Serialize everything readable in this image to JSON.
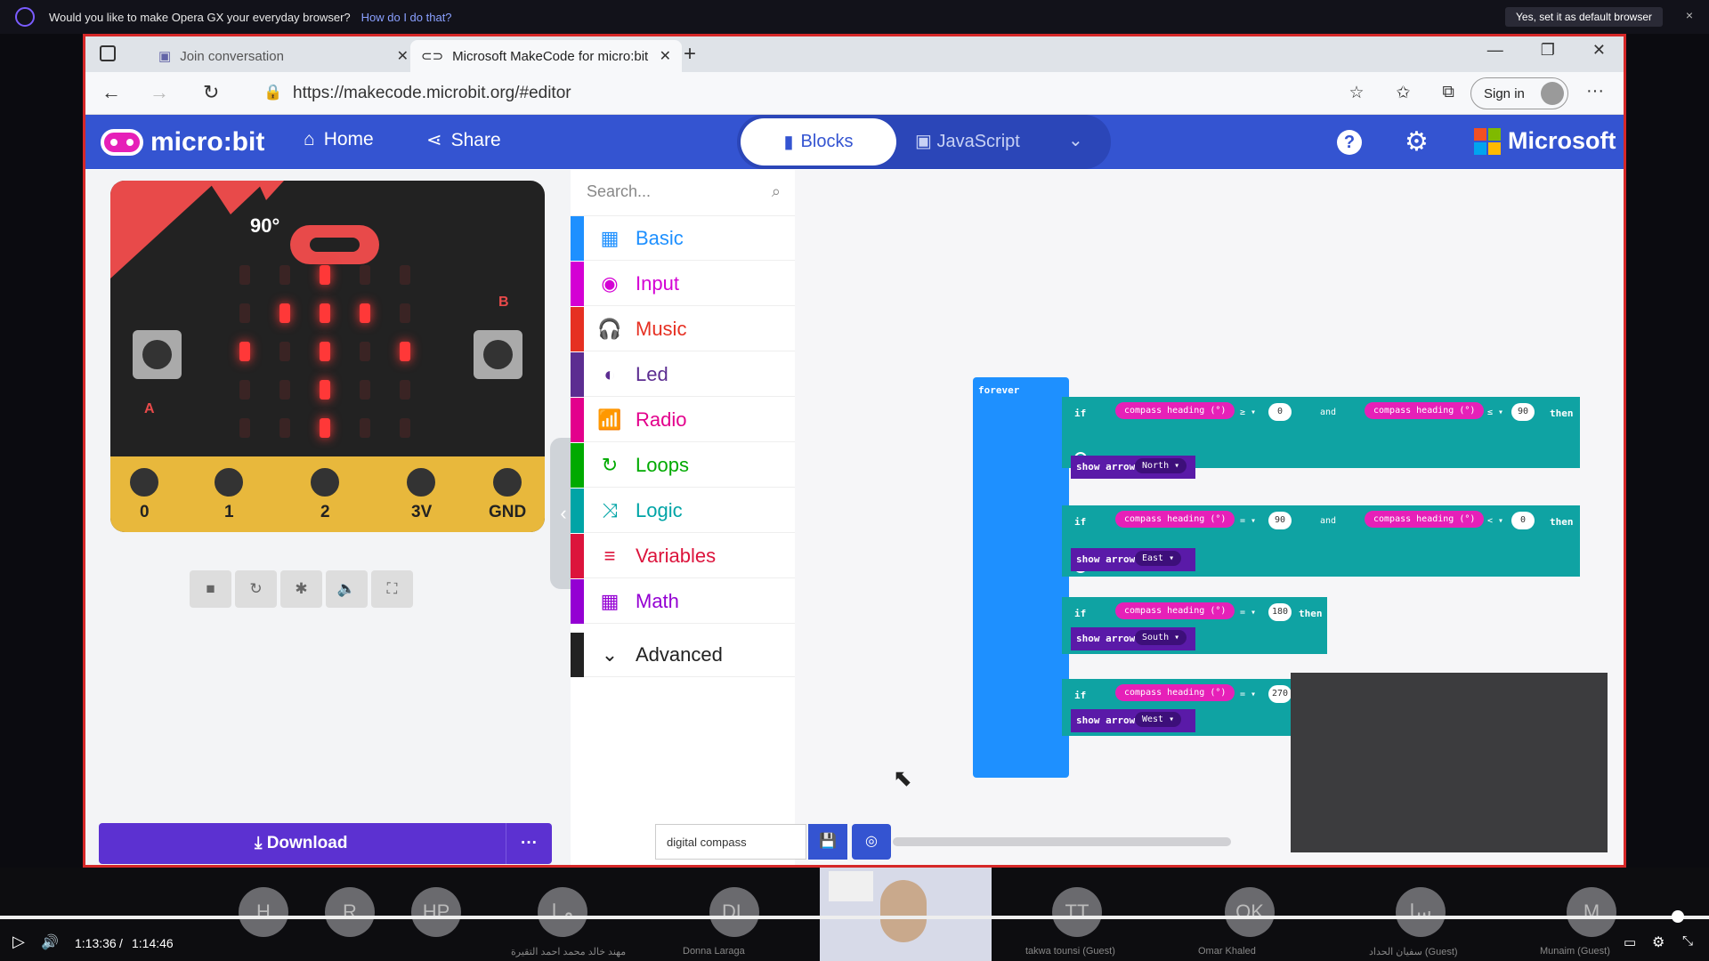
{
  "opera_bar": {
    "question": "Would you like to make Opera GX your everyday browser?",
    "link": "How do I do that?",
    "yes_button": "Yes, set it as default browser",
    "close": "×"
  },
  "tabs": [
    {
      "label": "Join conversation",
      "close": "✕"
    },
    {
      "label": "Microsoft MakeCode for micro:bit",
      "close": "✕"
    }
  ],
  "new_tab": "+",
  "window_controls": {
    "minimize": "—",
    "restore": "❐",
    "close": "✕"
  },
  "address": {
    "url": "https://makecode.microbit.org/#editor",
    "sign_in": "Sign in",
    "more": "···"
  },
  "header": {
    "logo": "micro:bit",
    "home": "Home",
    "share": "Share",
    "blocks": "Blocks",
    "javascript": "JavaScript",
    "help": "?",
    "brand": "Microsoft"
  },
  "simulator": {
    "heading": "90°",
    "pins": [
      "0",
      "1",
      "2",
      "3V",
      "GND"
    ],
    "button_a": "A",
    "button_b": "B",
    "leds_on": [
      [
        0,
        2
      ],
      [
        1,
        1
      ],
      [
        1,
        2
      ],
      [
        1,
        3
      ],
      [
        2,
        0
      ],
      [
        2,
        2
      ],
      [
        2,
        4
      ],
      [
        3,
        2
      ],
      [
        4,
        2
      ]
    ]
  },
  "download": {
    "label": "Download",
    "more": "···"
  },
  "toolbox": {
    "search_placeholder": "Search...",
    "categories": [
      {
        "label": "Basic",
        "color": "#1e90ff",
        "icon": "▦"
      },
      {
        "label": "Input",
        "color": "#d400d4",
        "icon": "◉"
      },
      {
        "label": "Music",
        "color": "#e63022",
        "icon": "🎧"
      },
      {
        "label": "Led",
        "color": "#5c2d91",
        "icon": "◐"
      },
      {
        "label": "Radio",
        "color": "#e3008c",
        "icon": "📶"
      },
      {
        "label": "Loops",
        "color": "#00aa00",
        "icon": "↻"
      },
      {
        "label": "Logic",
        "color": "#00a4a6",
        "icon": "⤨"
      },
      {
        "label": "Variables",
        "color": "#dc143c",
        "icon": "≡"
      },
      {
        "label": "Math",
        "color": "#9400d3",
        "icon": "▦"
      }
    ],
    "advanced": "Advanced"
  },
  "blocks": {
    "forever": "forever",
    "if": "if",
    "then": "then",
    "and": "and",
    "show_arrow": "show arrow",
    "compass": "compass heading (°)",
    "rows": [
      {
        "op1": "≥ ▾",
        "v1": "0",
        "op2": "≤ ▾",
        "v2": "90",
        "dir": "North ▾"
      },
      {
        "op1": "= ▾",
        "v1": "90",
        "op2": "< ▾",
        "v2": "0",
        "dir": "East ▾"
      },
      {
        "op1": "= ▾",
        "v1": "180",
        "dir": "South ▾"
      },
      {
        "op1": "= ▾",
        "v1": "270",
        "dir": "West ▾"
      }
    ]
  },
  "project": {
    "name": "digital compass"
  },
  "participants": [
    {
      "initials": "H",
      "name": ""
    },
    {
      "initials": "R",
      "name": ""
    },
    {
      "initials": "HP",
      "name": ""
    },
    {
      "initials": "مـا",
      "name": "مهند خالد محمد احمد التقيرة"
    },
    {
      "initials": "DL",
      "name": "Donna Laraga"
    },
    {
      "initials": "TT",
      "name": "takwa tounsi (Guest)"
    },
    {
      "initials": "OK",
      "name": "Omar Khaled"
    },
    {
      "initials": "سا",
      "name": "سفيان الحداد (Guest)"
    },
    {
      "initials": "M",
      "name": "Munaim (Guest)"
    }
  ],
  "player": {
    "time": "1:13:36",
    "duration": "1:14:46",
    "separator": "/",
    "progress": 0.984
  }
}
